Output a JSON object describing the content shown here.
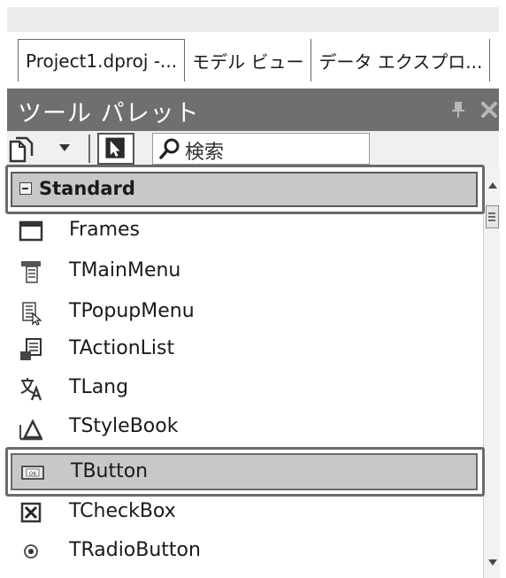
{
  "tabs": [
    {
      "label": "Project1.dproj -..."
    },
    {
      "label": "モデル ビュー"
    },
    {
      "label": "データ エクスプロ..."
    }
  ],
  "palette": {
    "title": "ツール パレット"
  },
  "search": {
    "placeholder": "検索"
  },
  "category": {
    "label": "Standard",
    "expanded": true
  },
  "items": [
    {
      "label": "Frames",
      "icon": "frames-icon"
    },
    {
      "label": "TMainMenu",
      "icon": "main-menu-icon"
    },
    {
      "label": "TPopupMenu",
      "icon": "popup-menu-icon"
    },
    {
      "label": "TActionList",
      "icon": "action-list-icon"
    },
    {
      "label": "TLang",
      "icon": "lang-icon"
    },
    {
      "label": "TStyleBook",
      "icon": "style-book-icon"
    },
    {
      "label": "TButton",
      "icon": "button-icon",
      "selected": true
    },
    {
      "label": "TCheckBox",
      "icon": "checkbox-icon"
    },
    {
      "label": "TRadioButton",
      "icon": "radio-button-icon"
    }
  ],
  "colors": {
    "header_bg": "#6f6f6f",
    "selected_bg": "#c8c8c8",
    "outline": "#6a6a6a"
  }
}
